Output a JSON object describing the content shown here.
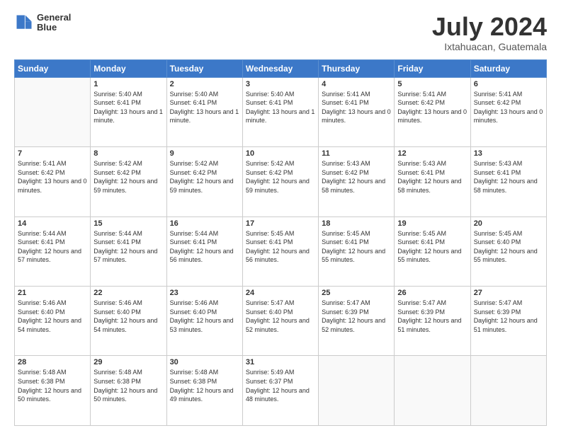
{
  "logo": {
    "line1": "General",
    "line2": "Blue"
  },
  "title": "July 2024",
  "location": "Ixtahuacan, Guatemala",
  "days_of_week": [
    "Sunday",
    "Monday",
    "Tuesday",
    "Wednesday",
    "Thursday",
    "Friday",
    "Saturday"
  ],
  "weeks": [
    [
      {
        "day": "",
        "sunrise": "",
        "sunset": "",
        "daylight": ""
      },
      {
        "day": "1",
        "sunrise": "Sunrise: 5:40 AM",
        "sunset": "Sunset: 6:41 PM",
        "daylight": "Daylight: 13 hours and 1 minute."
      },
      {
        "day": "2",
        "sunrise": "Sunrise: 5:40 AM",
        "sunset": "Sunset: 6:41 PM",
        "daylight": "Daylight: 13 hours and 1 minute."
      },
      {
        "day": "3",
        "sunrise": "Sunrise: 5:40 AM",
        "sunset": "Sunset: 6:41 PM",
        "daylight": "Daylight: 13 hours and 1 minute."
      },
      {
        "day": "4",
        "sunrise": "Sunrise: 5:41 AM",
        "sunset": "Sunset: 6:41 PM",
        "daylight": "Daylight: 13 hours and 0 minutes."
      },
      {
        "day": "5",
        "sunrise": "Sunrise: 5:41 AM",
        "sunset": "Sunset: 6:42 PM",
        "daylight": "Daylight: 13 hours and 0 minutes."
      },
      {
        "day": "6",
        "sunrise": "Sunrise: 5:41 AM",
        "sunset": "Sunset: 6:42 PM",
        "daylight": "Daylight: 13 hours and 0 minutes."
      }
    ],
    [
      {
        "day": "7",
        "sunrise": "Sunrise: 5:41 AM",
        "sunset": "Sunset: 6:42 PM",
        "daylight": "Daylight: 13 hours and 0 minutes."
      },
      {
        "day": "8",
        "sunrise": "Sunrise: 5:42 AM",
        "sunset": "Sunset: 6:42 PM",
        "daylight": "Daylight: 12 hours and 59 minutes."
      },
      {
        "day": "9",
        "sunrise": "Sunrise: 5:42 AM",
        "sunset": "Sunset: 6:42 PM",
        "daylight": "Daylight: 12 hours and 59 minutes."
      },
      {
        "day": "10",
        "sunrise": "Sunrise: 5:42 AM",
        "sunset": "Sunset: 6:42 PM",
        "daylight": "Daylight: 12 hours and 59 minutes."
      },
      {
        "day": "11",
        "sunrise": "Sunrise: 5:43 AM",
        "sunset": "Sunset: 6:42 PM",
        "daylight": "Daylight: 12 hours and 58 minutes."
      },
      {
        "day": "12",
        "sunrise": "Sunrise: 5:43 AM",
        "sunset": "Sunset: 6:41 PM",
        "daylight": "Daylight: 12 hours and 58 minutes."
      },
      {
        "day": "13",
        "sunrise": "Sunrise: 5:43 AM",
        "sunset": "Sunset: 6:41 PM",
        "daylight": "Daylight: 12 hours and 58 minutes."
      }
    ],
    [
      {
        "day": "14",
        "sunrise": "Sunrise: 5:44 AM",
        "sunset": "Sunset: 6:41 PM",
        "daylight": "Daylight: 12 hours and 57 minutes."
      },
      {
        "day": "15",
        "sunrise": "Sunrise: 5:44 AM",
        "sunset": "Sunset: 6:41 PM",
        "daylight": "Daylight: 12 hours and 57 minutes."
      },
      {
        "day": "16",
        "sunrise": "Sunrise: 5:44 AM",
        "sunset": "Sunset: 6:41 PM",
        "daylight": "Daylight: 12 hours and 56 minutes."
      },
      {
        "day": "17",
        "sunrise": "Sunrise: 5:45 AM",
        "sunset": "Sunset: 6:41 PM",
        "daylight": "Daylight: 12 hours and 56 minutes."
      },
      {
        "day": "18",
        "sunrise": "Sunrise: 5:45 AM",
        "sunset": "Sunset: 6:41 PM",
        "daylight": "Daylight: 12 hours and 55 minutes."
      },
      {
        "day": "19",
        "sunrise": "Sunrise: 5:45 AM",
        "sunset": "Sunset: 6:41 PM",
        "daylight": "Daylight: 12 hours and 55 minutes."
      },
      {
        "day": "20",
        "sunrise": "Sunrise: 5:45 AM",
        "sunset": "Sunset: 6:40 PM",
        "daylight": "Daylight: 12 hours and 55 minutes."
      }
    ],
    [
      {
        "day": "21",
        "sunrise": "Sunrise: 5:46 AM",
        "sunset": "Sunset: 6:40 PM",
        "daylight": "Daylight: 12 hours and 54 minutes."
      },
      {
        "day": "22",
        "sunrise": "Sunrise: 5:46 AM",
        "sunset": "Sunset: 6:40 PM",
        "daylight": "Daylight: 12 hours and 54 minutes."
      },
      {
        "day": "23",
        "sunrise": "Sunrise: 5:46 AM",
        "sunset": "Sunset: 6:40 PM",
        "daylight": "Daylight: 12 hours and 53 minutes."
      },
      {
        "day": "24",
        "sunrise": "Sunrise: 5:47 AM",
        "sunset": "Sunset: 6:40 PM",
        "daylight": "Daylight: 12 hours and 52 minutes."
      },
      {
        "day": "25",
        "sunrise": "Sunrise: 5:47 AM",
        "sunset": "Sunset: 6:39 PM",
        "daylight": "Daylight: 12 hours and 52 minutes."
      },
      {
        "day": "26",
        "sunrise": "Sunrise: 5:47 AM",
        "sunset": "Sunset: 6:39 PM",
        "daylight": "Daylight: 12 hours and 51 minutes."
      },
      {
        "day": "27",
        "sunrise": "Sunrise: 5:47 AM",
        "sunset": "Sunset: 6:39 PM",
        "daylight": "Daylight: 12 hours and 51 minutes."
      }
    ],
    [
      {
        "day": "28",
        "sunrise": "Sunrise: 5:48 AM",
        "sunset": "Sunset: 6:38 PM",
        "daylight": "Daylight: 12 hours and 50 minutes."
      },
      {
        "day": "29",
        "sunrise": "Sunrise: 5:48 AM",
        "sunset": "Sunset: 6:38 PM",
        "daylight": "Daylight: 12 hours and 50 minutes."
      },
      {
        "day": "30",
        "sunrise": "Sunrise: 5:48 AM",
        "sunset": "Sunset: 6:38 PM",
        "daylight": "Daylight: 12 hours and 49 minutes."
      },
      {
        "day": "31",
        "sunrise": "Sunrise: 5:49 AM",
        "sunset": "Sunset: 6:37 PM",
        "daylight": "Daylight: 12 hours and 48 minutes."
      },
      {
        "day": "",
        "sunrise": "",
        "sunset": "",
        "daylight": ""
      },
      {
        "day": "",
        "sunrise": "",
        "sunset": "",
        "daylight": ""
      },
      {
        "day": "",
        "sunrise": "",
        "sunset": "",
        "daylight": ""
      }
    ]
  ]
}
